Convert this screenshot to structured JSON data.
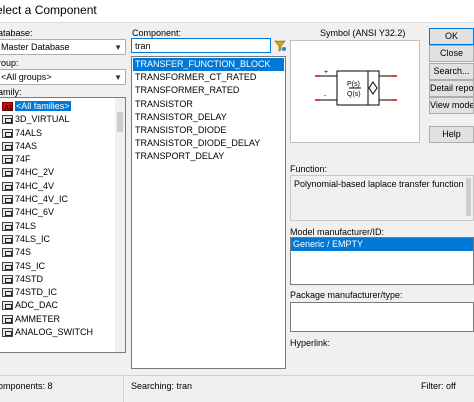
{
  "window": {
    "title": "elect a Component"
  },
  "database": {
    "label": "atabase:",
    "value": "Master Database"
  },
  "group": {
    "label": "roup:",
    "value": "<All groups>"
  },
  "family": {
    "label": "amily:",
    "items": [
      {
        "label": "<All families>",
        "icon": "all-families-icon",
        "selected": true
      },
      {
        "label": "3D_VIRTUAL",
        "icon": "component-family-icon"
      },
      {
        "label": "74ALS",
        "icon": "component-family-icon"
      },
      {
        "label": "74AS",
        "icon": "component-family-icon"
      },
      {
        "label": "74F",
        "icon": "component-family-icon"
      },
      {
        "label": "74HC_2V",
        "icon": "component-family-icon"
      },
      {
        "label": "74HC_4V",
        "icon": "component-family-icon"
      },
      {
        "label": "74HC_4V_IC",
        "icon": "component-family-icon"
      },
      {
        "label": "74HC_6V",
        "icon": "component-family-icon"
      },
      {
        "label": "74LS",
        "icon": "component-family-icon"
      },
      {
        "label": "74LS_IC",
        "icon": "component-family-icon"
      },
      {
        "label": "74S",
        "icon": "component-family-icon"
      },
      {
        "label": "74S_IC",
        "icon": "component-family-icon"
      },
      {
        "label": "74STD",
        "icon": "component-family-icon"
      },
      {
        "label": "74STD_IC",
        "icon": "component-family-icon"
      },
      {
        "label": "ADC_DAC",
        "icon": "component-family-icon"
      },
      {
        "label": "AMMETER",
        "icon": "component-family-icon"
      },
      {
        "label": "ANALOG_SWITCH",
        "icon": "component-family-icon"
      }
    ]
  },
  "component": {
    "label": "Component:",
    "search_value": "tran",
    "items": [
      {
        "label": "TRANSFER_FUNCTION_BLOCK",
        "selected": true
      },
      {
        "label": "TRANSFORMER_CT_RATED"
      },
      {
        "label": "TRANSFORMER_RATED"
      },
      {
        "label": "TRANSISTOR"
      },
      {
        "label": "TRANSISTOR_DELAY"
      },
      {
        "label": "TRANSISTOR_DIODE"
      },
      {
        "label": "TRANSISTOR_DIODE_DELAY"
      },
      {
        "label": "TRANSPORT_DELAY"
      }
    ]
  },
  "symbol": {
    "label": "Symbol (ANSI Y32.2)",
    "numerator": "P(s)",
    "denominator": "Q(s)",
    "plus": "+",
    "minus": "-"
  },
  "buttons": {
    "ok": "OK",
    "close": "Close",
    "search": "Search...",
    "detail_report": "Detail report",
    "view_model": "View model",
    "help": "Help"
  },
  "function": {
    "label": "Function:",
    "text": "Polynomial-based laplace transfer function."
  },
  "model_manufacturer": {
    "label": "Model manufacturer/ID:",
    "items": [
      {
        "label": "Generic / EMPTY",
        "selected": true
      }
    ]
  },
  "package_manufacturer": {
    "label": "Package manufacturer/type:"
  },
  "hyperlink": {
    "label": "Hyperlink:"
  },
  "status": {
    "components": "omponents: 8",
    "searching": "Searching: tran",
    "filter": "Filter: off"
  },
  "colors": {
    "selection": "#0078d7",
    "symbol_red": "#e00000"
  }
}
